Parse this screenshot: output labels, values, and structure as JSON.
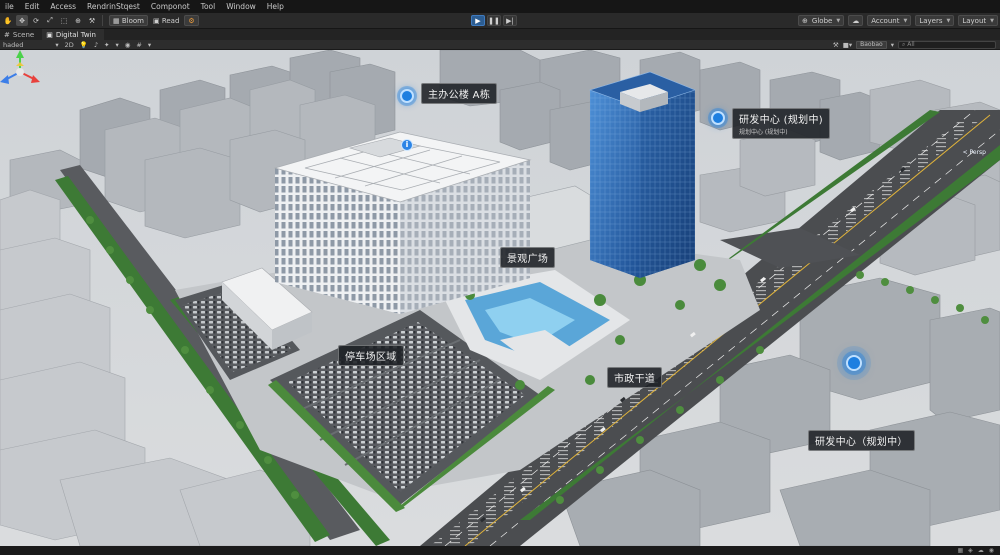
{
  "menu": [
    "ile",
    "Edit",
    "Access",
    "RendrinStqest",
    "Componot",
    "Tool",
    "Window",
    "Help"
  ],
  "toolbar": {
    "bloom_label": "Bloom",
    "read_label": "Read",
    "right": {
      "globe_label": "Globe",
      "account_label": "Account",
      "layers_label": "Layers",
      "layout_label": "Layout"
    }
  },
  "tabs": [
    {
      "label": "Scene"
    },
    {
      "label": "Digital Twin"
    }
  ],
  "scenebar": {
    "shading": "haded",
    "mode_2d": "2D",
    "gizmos_label": "Baobao",
    "search_placeholder": "All"
  },
  "scene": {
    "labels": {
      "main_office": "主办公楼 A栋",
      "rnd_center": "研发中心 (规划中)",
      "rnd_center_sub": "规划中心 (规划中)",
      "landscape_plaza": "景观广场",
      "parking_area": "停车场区域",
      "municipal_road": "市政干道",
      "rnd_center_2": "研发中心（规划中）"
    },
    "persp_label": "< Persp",
    "colors": {
      "glass_tower": "#2f6db8",
      "pin_blue": "#1e7fe0",
      "ground": "#d5d8db",
      "road": "#4b4d50"
    }
  }
}
